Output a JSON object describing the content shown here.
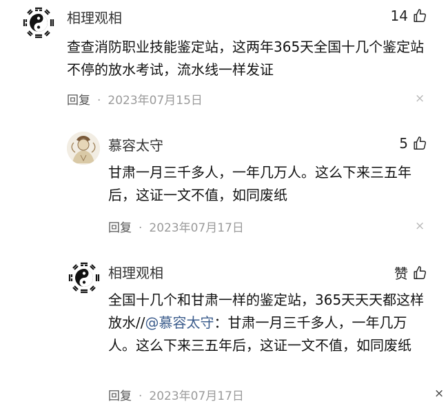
{
  "comments": [
    {
      "user": "相理观相",
      "likes": "14",
      "avatar_icon": "bagua-yin-yang-icon",
      "text": "查查消防职业技能鉴定站，这两年365天全国十几个鉴定站不停的放水考试，流水线一样发证",
      "reply_label": "回复",
      "date": "2023年07月15日",
      "close_glyph": "×"
    },
    {
      "user": "慕容太守",
      "likes": "5",
      "avatar_icon": "painted-figure-avatar",
      "text": "甘肃一月三千多人，一年几万人。这么下来三五年后，这证一文不值，如同废纸",
      "reply_label": "回复",
      "date": "2023年07月17日",
      "close_glyph": "×"
    },
    {
      "user": "相理观相",
      "likes": "赞",
      "avatar_icon": "bagua-yin-yang-icon",
      "text_before": "全国十几个和甘肃一样的鉴定站，365天天天都这样放水//",
      "mention": "@慕容太守",
      "text_after": "：甘肃一月三千多人，一年几万人。这么下来三五年后，这证一文不值，如同废纸",
      "reply_label": "回复",
      "date": "2023年07月17日",
      "close_glyph": "×"
    }
  ],
  "icons": {
    "like": "thumbs-up-icon",
    "close": "close-icon"
  },
  "colors": {
    "mention": "#3b5c8c",
    "meta": "#9a9a9a"
  }
}
